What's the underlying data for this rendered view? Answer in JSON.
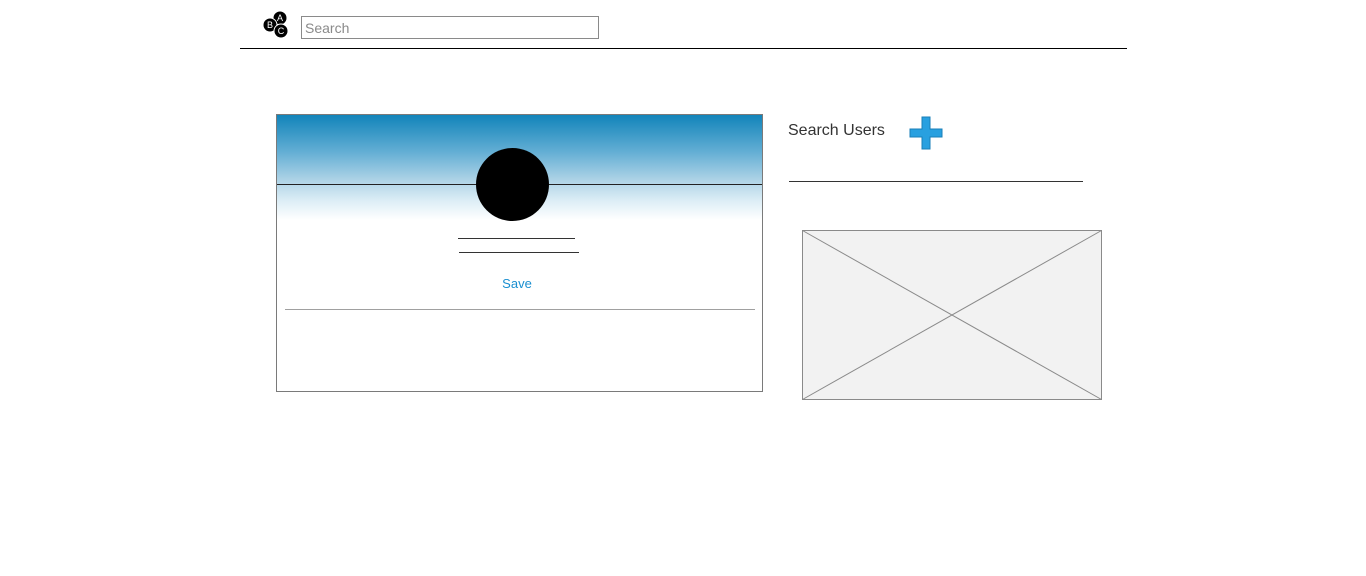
{
  "header": {
    "logo_letters": [
      "A",
      "B",
      "C"
    ],
    "search": {
      "placeholder": "Search",
      "value": ""
    }
  },
  "profile_card": {
    "save_label": "Save"
  },
  "sidebar": {
    "title": "Search Users",
    "add_icon": "plus-icon",
    "image_placeholder": "image-placeholder"
  },
  "colors": {
    "accent": "#1a8fd0",
    "banner_top": "#1284ba",
    "add_icon": "#28a0e0",
    "placeholder_fill": "#f2f2f2"
  }
}
